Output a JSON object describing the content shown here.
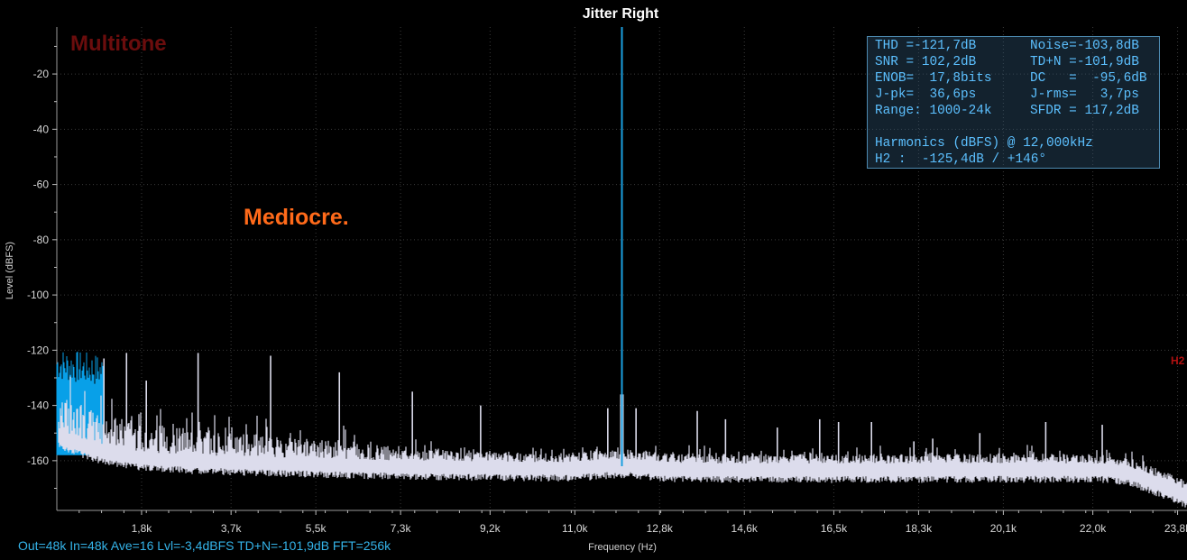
{
  "chart_data": {
    "type": "line",
    "title": "Jitter Right",
    "xlabel": "Frequency (Hz)",
    "ylabel": "Level (dBFS)",
    "xlim": [
      0,
      24000
    ],
    "ylim": [
      -178,
      -3
    ],
    "y_ticks": [
      -20,
      -40,
      -60,
      -80,
      -100,
      -120,
      -140,
      -160
    ],
    "x_ticks": [
      {
        "value": 1800,
        "label": "1,8k"
      },
      {
        "value": 3700,
        "label": "3,7k"
      },
      {
        "value": 5500,
        "label": "5,5k"
      },
      {
        "value": 7300,
        "label": "7,3k"
      },
      {
        "value": 9200,
        "label": "9,2k"
      },
      {
        "value": 11000,
        "label": "11,0k"
      },
      {
        "value": 12800,
        "label": "12,8k"
      },
      {
        "value": 14600,
        "label": "14,6k"
      },
      {
        "value": 16500,
        "label": "16,5k"
      },
      {
        "value": 18300,
        "label": "18,3k"
      },
      {
        "value": 20100,
        "label": "20,1k"
      },
      {
        "value": 22000,
        "label": "22,0k"
      },
      {
        "value": 23800,
        "label": "23,8k"
      }
    ],
    "grid": true,
    "fundamental": {
      "x": 12000,
      "y": -3
    },
    "noise_floor": [
      [
        0,
        -151
      ],
      [
        300,
        -153
      ],
      [
        600,
        -155
      ],
      [
        1000,
        -157
      ],
      [
        1500,
        -158.5
      ],
      [
        2000,
        -159.5
      ],
      [
        3000,
        -160.5
      ],
      [
        4000,
        -161
      ],
      [
        5000,
        -161.5
      ],
      [
        6000,
        -162
      ],
      [
        7000,
        -162.3
      ],
      [
        8000,
        -162.6
      ],
      [
        9000,
        -162.8
      ],
      [
        10000,
        -163
      ],
      [
        11000,
        -163
      ],
      [
        11800,
        -162
      ],
      [
        12000,
        -162
      ],
      [
        12200,
        -162
      ],
      [
        13000,
        -163.3
      ],
      [
        14000,
        -163.5
      ],
      [
        16000,
        -163.6
      ],
      [
        18000,
        -163.6
      ],
      [
        20000,
        -163.5
      ],
      [
        21500,
        -163.5
      ],
      [
        22300,
        -163.6
      ],
      [
        22800,
        -165
      ],
      [
        23300,
        -168
      ],
      [
        23700,
        -171
      ],
      [
        24000,
        -173
      ]
    ],
    "spurs": [
      {
        "x": 1000,
        "y": -123
      },
      {
        "x": 1480,
        "y": -121
      },
      {
        "x": 1900,
        "y": -131
      },
      {
        "x": 3000,
        "y": -121
      },
      {
        "x": 4540,
        "y": -122
      },
      {
        "x": 6000,
        "y": -128
      },
      {
        "x": 7550,
        "y": -135
      },
      {
        "x": 9000,
        "y": -140
      },
      {
        "x": 11700,
        "y": -141
      },
      {
        "x": 12000,
        "y": -120
      },
      {
        "x": 12300,
        "y": -141
      },
      {
        "x": 13600,
        "y": -142
      },
      {
        "x": 14200,
        "y": -145
      },
      {
        "x": 15300,
        "y": -148
      },
      {
        "x": 16200,
        "y": -145
      },
      {
        "x": 16600,
        "y": -146
      },
      {
        "x": 17300,
        "y": -146
      },
      {
        "x": 18200,
        "y": -153
      },
      {
        "x": 18600,
        "y": -152
      },
      {
        "x": 19600,
        "y": -150
      },
      {
        "x": 21000,
        "y": -146
      },
      {
        "x": 22200,
        "y": -147
      }
    ],
    "lowfreq_band": {
      "x0": 0,
      "x1": 1000,
      "top": -131,
      "bottom": -158
    }
  },
  "labels": {
    "mode": "Multitone",
    "rating": "Mediocre.",
    "h2_marker": "H2"
  },
  "stats": {
    "thd": "THD =-121,7dB",
    "noise": "Noise=-103,8dB",
    "snr": "SNR = 102,2dB",
    "tdn": "TD+N =-101,9dB",
    "enob": "ENOB=  17,8bits",
    "dc": "DC   =  -95,6dB",
    "jpk": "J-pk=  36,6ps",
    "jrms": "J-rms=   3,7ps",
    "range": "Range: 1000-24k",
    "sfdr": "SFDR = 117,2dB",
    "harmonics_header": "Harmonics (dBFS) @ 12,000kHz",
    "h2": "H2 :  -125,4dB / +146°"
  },
  "footer": "Out=48k  In=48k  Ave=16  Lvl=-3,4dBFS  TD+N=-101,9dB  FFT=256k",
  "colors": {
    "background": "#000000",
    "trace": "#dcdcec",
    "fundamental": "#1a9fe0",
    "lowfreq": "#08a0e8",
    "stats_text": "#5cc0ff",
    "footer": "#34b3e8",
    "rating": "#ff6a1a",
    "mode": "#6b0d0d",
    "marker": "#b01010"
  }
}
